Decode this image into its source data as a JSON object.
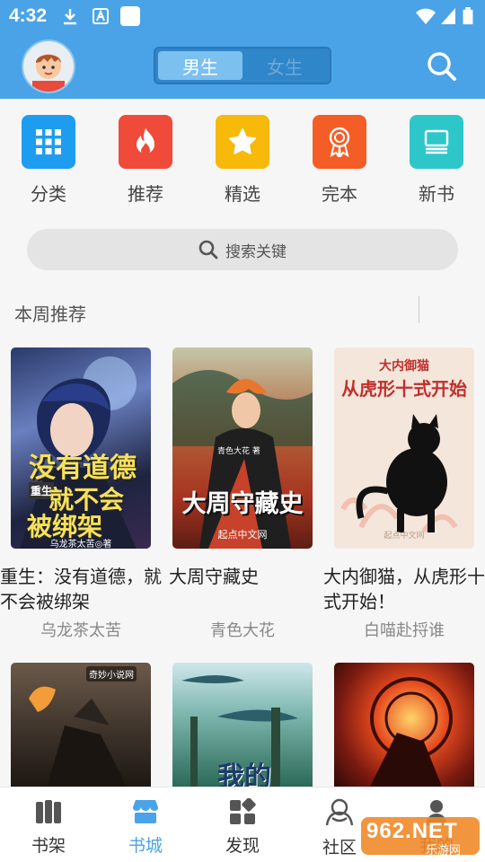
{
  "status": {
    "time": "4:32"
  },
  "header": {
    "tabs": [
      {
        "label": "男生",
        "active": true
      },
      {
        "label": "女生",
        "active": false
      }
    ],
    "accent_color": "#4aa3e6"
  },
  "categories": [
    {
      "label": "分类",
      "icon": "grid-icon",
      "color": "#1e9df0"
    },
    {
      "label": "推荐",
      "icon": "fire-icon",
      "color": "#f04a3a"
    },
    {
      "label": "精选",
      "icon": "star-icon",
      "color": "#f7b90a"
    },
    {
      "label": "完本",
      "icon": "medal-icon",
      "color": "#f55d26"
    },
    {
      "label": "新书",
      "icon": "book-icon",
      "color": "#2ec7c9"
    }
  ],
  "search": {
    "placeholder": "搜索关键"
  },
  "section": {
    "title": "本周推荐"
  },
  "books": [
    {
      "title": "重生：没有道德，就不会被绑架",
      "author": "乌龙茶太苦",
      "cover_text": [
        "没有道德",
        "就不会",
        "被绑架"
      ],
      "cover_tag": "重生",
      "cover_sub": "乌龙茶太苦◎著"
    },
    {
      "title": "大周守藏史",
      "author": "青色大花",
      "cover_text": [
        "大周守藏史"
      ],
      "cover_sub": "起点中文网",
      "cover_small": "青色大花 著"
    },
    {
      "title": "大内御猫，从虎形十式开始！",
      "author": "白喵赴捋谁",
      "cover_text": [
        "大内御猫",
        "从虎形十式开始"
      ],
      "cover_sub": "起点中文网"
    }
  ],
  "books_row2": [
    {
      "cover_badge": "奇妙小说网"
    },
    {
      "cover_text": "我的"
    },
    {}
  ],
  "bottom_nav": [
    {
      "label": "书架",
      "icon": "bookshelf-icon",
      "active": false
    },
    {
      "label": "书城",
      "icon": "store-icon",
      "active": true
    },
    {
      "label": "发现",
      "icon": "discover-icon",
      "active": false
    },
    {
      "label": "社区",
      "icon": "community-icon",
      "active": false
    },
    {
      "label": "我的",
      "icon": "profile-icon",
      "active": false
    }
  ],
  "watermark": {
    "text": "962.NET",
    "sub": "乐游网"
  }
}
